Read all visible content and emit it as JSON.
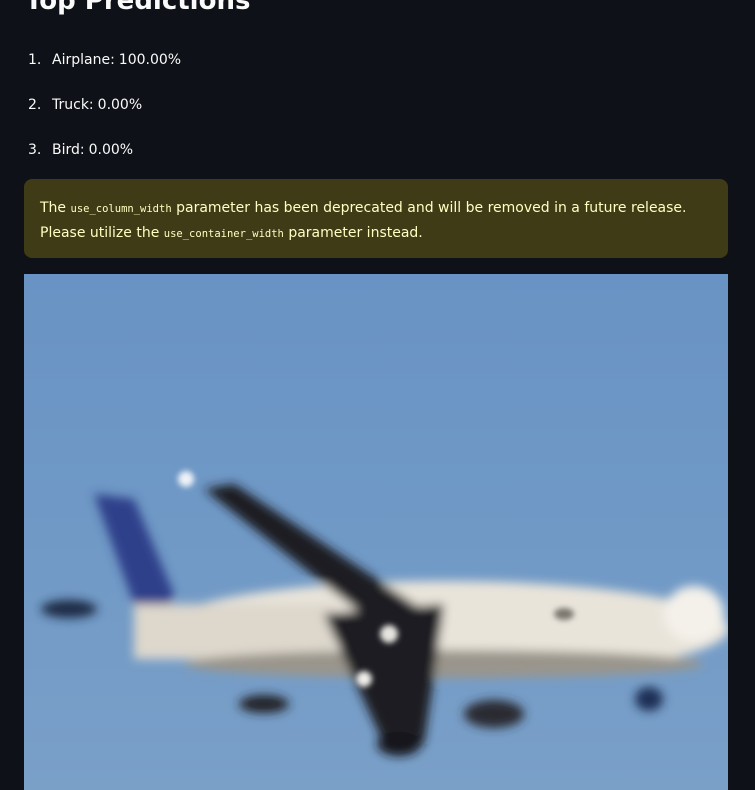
{
  "heading": "Top Predictions",
  "predictions": [
    {
      "rank": "1.",
      "label": "Airplane:",
      "value": "100.00%"
    },
    {
      "rank": "2.",
      "label": "Truck:",
      "value": "0.00%"
    },
    {
      "rank": "3.",
      "label": "Bird:",
      "value": "0.00%"
    }
  ],
  "warning": {
    "text_1": "The ",
    "code_1": "use_column_width",
    "text_2": " parameter has been deprecated and will be removed in a future release. Please utilize the ",
    "code_2": "use_container_width",
    "text_3": " parameter instead."
  },
  "image": {
    "subject": "airplane",
    "sky_color": "#6f98c7"
  }
}
